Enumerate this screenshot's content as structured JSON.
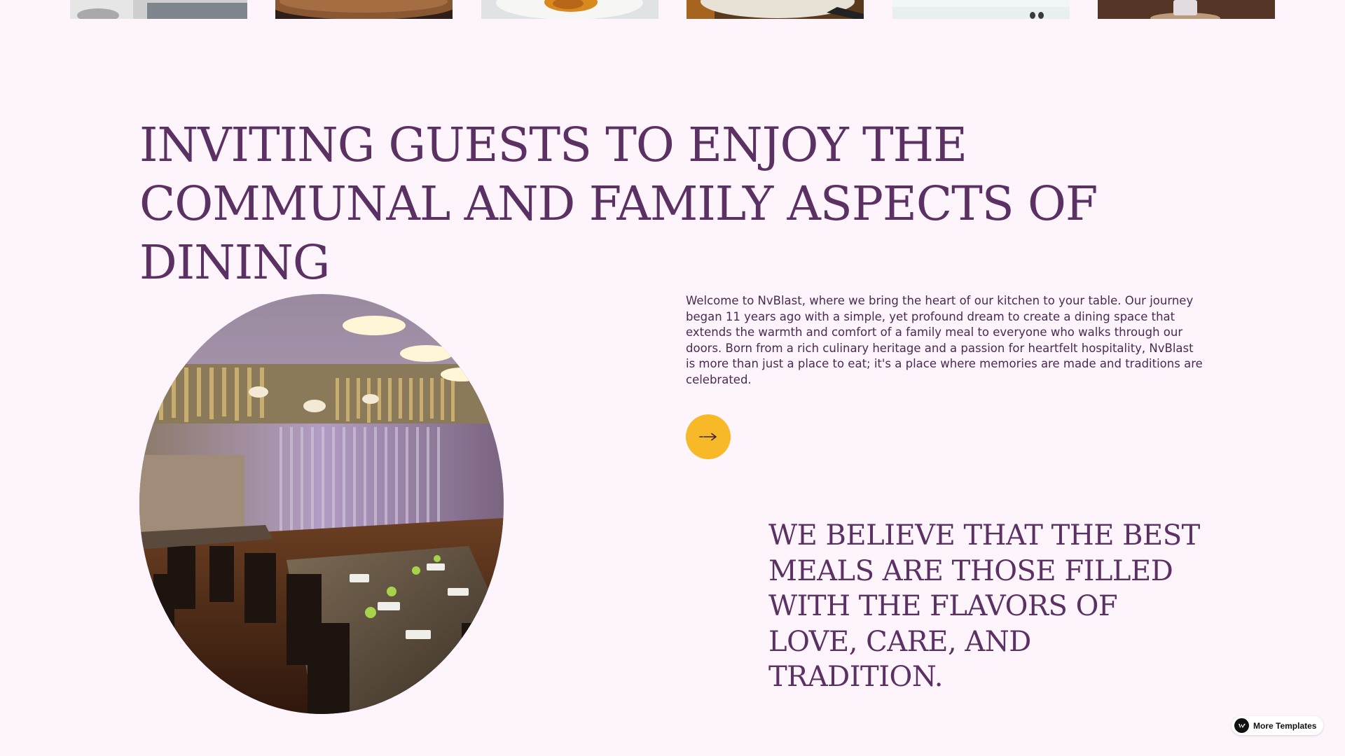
{
  "gallery": {
    "thumbnails": [
      {
        "icon": "dishes-thumbnail"
      },
      {
        "icon": "wooden-board-thumbnail"
      },
      {
        "icon": "plated-dish-thumbnail"
      },
      {
        "icon": "dining-plate-thumbnail"
      },
      {
        "icon": "light-table-thumbnail"
      },
      {
        "icon": "candle-table-thumbnail"
      }
    ]
  },
  "main": {
    "headline": "INVITING GUESTS TO ENJOY THE COMMUNAL AND FAMILY ASPECTS OF DINING",
    "intro": "Welcome to NvBlast, where we bring the heart of our kitchen to your table. Our journey began 11 years ago with a simple, yet profound dream to create a dining space that extends the warmth and comfort of a family meal to everyone who walks through our doors. Born from a rich culinary heritage and a passion for heartfelt hospitality, NvBlast is more than just a place to eat; it's a place where memories are made and traditions are celebrated.",
    "arrow_icon": "arrow-right-icon",
    "belief": "WE BELIEVE THAT THE BEST MEALS ARE THOSE FILLED WITH THE FLAVORS OF LOVE, CARE, AND TRADITION.",
    "photo": "restaurant-interior-photo"
  },
  "badge": {
    "label": "More Templates",
    "icon": "webflow-logo-icon"
  },
  "colors": {
    "background": "#fdf4fc",
    "heading": "#5b3063",
    "body_text": "#4b2a52",
    "accent": "#f7b928"
  }
}
